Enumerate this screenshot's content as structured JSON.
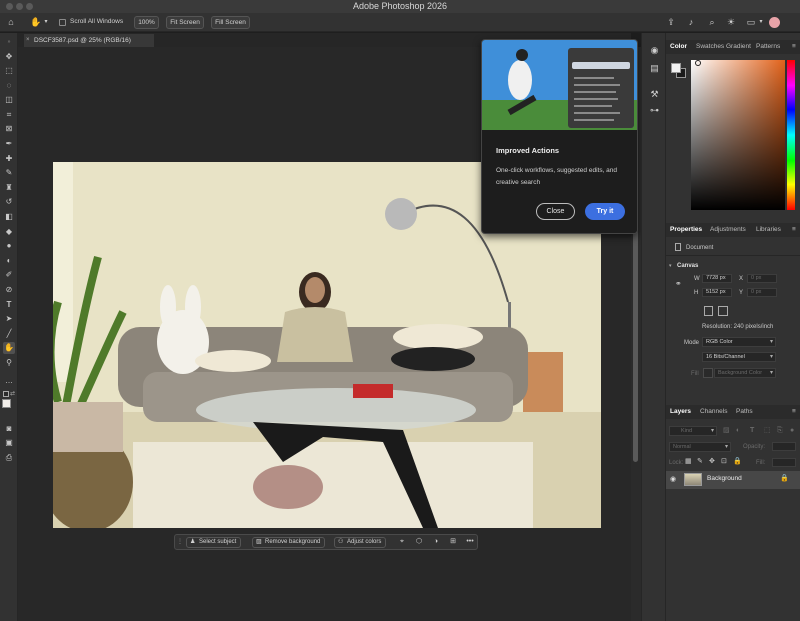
{
  "app": {
    "title": "Adobe Photoshop 2026"
  },
  "options_bar": {
    "scroll_all_windows": "Scroll All Windows",
    "zoom_button": "100%",
    "fit_screen": "Fit Screen",
    "fill_screen": "Fill Screen"
  },
  "document": {
    "tab_title": "DSCF3587.psd @ 25% (RGB/16)"
  },
  "popup": {
    "title": "Improved Actions",
    "description": "One-click workflows, suggested edits, and creative search",
    "close_label": "Close",
    "try_label": "Try it"
  },
  "taskbar": {
    "select_subject": "Select subject",
    "remove_background": "Remove background",
    "adjust_colors": "Adjust colors"
  },
  "color_panel": {
    "tabs": [
      "Color",
      "Swatches",
      "Gradient",
      "Patterns"
    ],
    "foreground": "#f2f2f2",
    "background": "#1a1a1a"
  },
  "properties_panel": {
    "tabs": [
      "Properties",
      "Adjustments",
      "Libraries"
    ],
    "type_label": "Document",
    "section": "Canvas",
    "w_label": "W",
    "w_value": "7728 px",
    "h_label": "H",
    "h_value": "5152 px",
    "x_label": "X",
    "x_value": "0 px",
    "y_label": "Y",
    "y_value": "0 px",
    "resolution": "Resolution: 240 pixels/inch",
    "mode_label": "Mode",
    "mode_value": "RGB Color",
    "bits_value": "16 Bits/Channel",
    "fill_label": "Fill",
    "fill_value": "Background Color"
  },
  "layers_panel": {
    "tabs": [
      "Layers",
      "Channels",
      "Paths"
    ],
    "kind_placeholder": "Kind",
    "blend_mode": "Normal",
    "opacity_label": "Opacity:",
    "lock_label": "Lock:",
    "fill_label": "Fill:",
    "layers": [
      {
        "name": "Background",
        "visible": true,
        "locked": true
      }
    ]
  }
}
